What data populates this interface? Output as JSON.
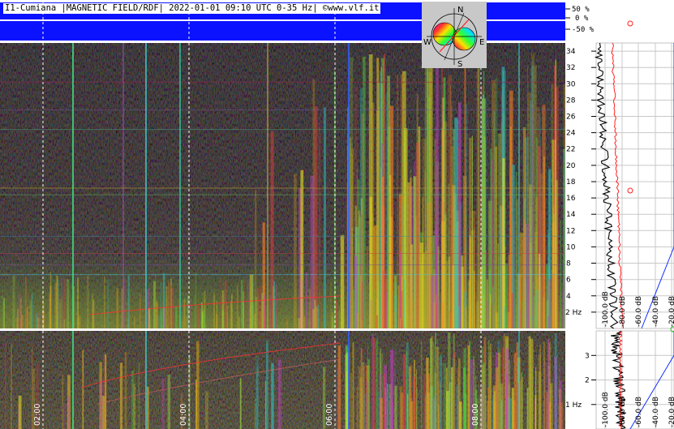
{
  "title": "I1-Cumiana |MAGNETIC FIELD/RDF| 2022-01-01 09:10 UTC 0-35 Hz| ©www.vlf.it",
  "compass": {
    "n": "N",
    "s": "S",
    "e": "E",
    "w": "W"
  },
  "percent_scale": [
    "50 %",
    "0 %",
    "-50 %"
  ],
  "colors": {
    "band": "#0b12ff",
    "spectrum_bg": "#1a1410",
    "white": "#ffffff",
    "red_marker": "#ff2020",
    "blue_curve": "#1030ff"
  },
  "chart_data": [
    {
      "type": "heatmap",
      "name": "main-spectrogram",
      "x_ticks": [
        "02:00",
        "04:00",
        "06:00",
        "08:00"
      ],
      "y_ticks": [
        "34",
        "32",
        "30",
        "28",
        "26",
        "24",
        "22",
        "20",
        "18",
        "16",
        "14",
        "12",
        "10",
        "8",
        "6",
        "4",
        "2 Hz"
      ],
      "y_values": [
        34,
        32,
        30,
        28,
        26,
        24,
        22,
        20,
        18,
        16,
        14,
        12,
        10,
        8,
        6,
        4,
        2
      ],
      "ylim": [
        0,
        35
      ],
      "db_ticks": [
        "-100.0 dB",
        "-80.0 dB",
        "-60.0 dB",
        "-40.0 dB",
        "-20.0 dB"
      ],
      "db_values": [
        -100,
        -80,
        -60,
        -40,
        -20
      ]
    },
    {
      "type": "heatmap",
      "name": "low-spectrogram",
      "x_ticks": [
        "02:00",
        "04:00",
        "06:00",
        "08:00"
      ],
      "y_ticks": [
        "3",
        "2",
        "1 Hz"
      ],
      "y_values": [
        3,
        2,
        1
      ],
      "ylim": [
        0,
        4
      ],
      "db_ticks": [
        "-100.0 dB",
        "-80.0 dB",
        "-60.0 dB",
        "-40.0 dB",
        "-20.0 dB"
      ],
      "db_values": [
        -100,
        -80,
        -60,
        -40,
        -20
      ]
    }
  ]
}
